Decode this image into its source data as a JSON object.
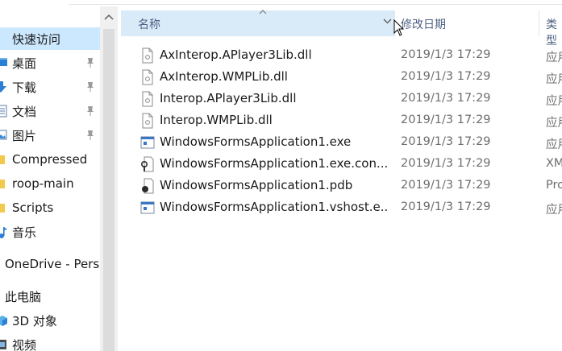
{
  "nav": {
    "items": [
      {
        "label": "快速访问",
        "icon": "star-icon",
        "pinned": false
      },
      {
        "label": "桌面",
        "icon": "desktop-icon",
        "pinned": true
      },
      {
        "label": "下载",
        "icon": "download-icon",
        "pinned": true
      },
      {
        "label": "文档",
        "icon": "documents-icon",
        "pinned": true
      },
      {
        "label": "图片",
        "icon": "pictures-icon",
        "pinned": true
      },
      {
        "label": "Compressed",
        "icon": "folder-icon",
        "pinned": false
      },
      {
        "label": "roop-main",
        "icon": "folder-icon",
        "pinned": false
      },
      {
        "label": "Scripts",
        "icon": "folder-icon",
        "pinned": false
      },
      {
        "label": "音乐",
        "icon": "music-icon",
        "pinned": false
      },
      {
        "label": "OneDrive - Perso",
        "icon": "onedrive-icon",
        "pinned": false
      },
      {
        "label": "此电脑",
        "icon": "computer-icon",
        "pinned": false
      },
      {
        "label": "3D 对象",
        "icon": "3d-objects-icon",
        "pinned": false
      },
      {
        "label": "视频",
        "icon": "videos-icon",
        "pinned": false
      }
    ]
  },
  "header": {
    "name_label": "名称",
    "date_label": "修改日期",
    "type_label": "类型"
  },
  "files": [
    {
      "name": "AxInterop.APlayer3Lib.dll",
      "date": "2019/1/3 17:29",
      "type": "应用",
      "icon": "dll-file-icon"
    },
    {
      "name": "AxInterop.WMPLib.dll",
      "date": "2019/1/3 17:29",
      "type": "应用",
      "icon": "dll-file-icon"
    },
    {
      "name": "Interop.APlayer3Lib.dll",
      "date": "2019/1/3 17:29",
      "type": "应用",
      "icon": "dll-file-icon"
    },
    {
      "name": "Interop.WMPLib.dll",
      "date": "2019/1/3 17:29",
      "type": "应用",
      "icon": "dll-file-icon"
    },
    {
      "name": "WindowsFormsApplication1.exe",
      "date": "2019/1/3 17:29",
      "type": "应用",
      "icon": "exe-file-icon"
    },
    {
      "name": "WindowsFormsApplication1.exe.con...",
      "date": "2019/1/3 17:29",
      "type": "XM",
      "icon": "config-file-icon"
    },
    {
      "name": "WindowsFormsApplication1.pdb",
      "date": "2019/1/3 17:29",
      "type": "Pro",
      "icon": "pdb-file-icon"
    },
    {
      "name": "WindowsFormsApplication1.vshost.e...",
      "date": "2019/1/3 17:29",
      "type": "应用",
      "icon": "exe-file-icon"
    }
  ],
  "colors": {
    "selected_nav": "#cce8ff",
    "header_hover": "#d9ebf9",
    "header_text": "#4d6082",
    "meta_text": "#6d6d6d"
  }
}
